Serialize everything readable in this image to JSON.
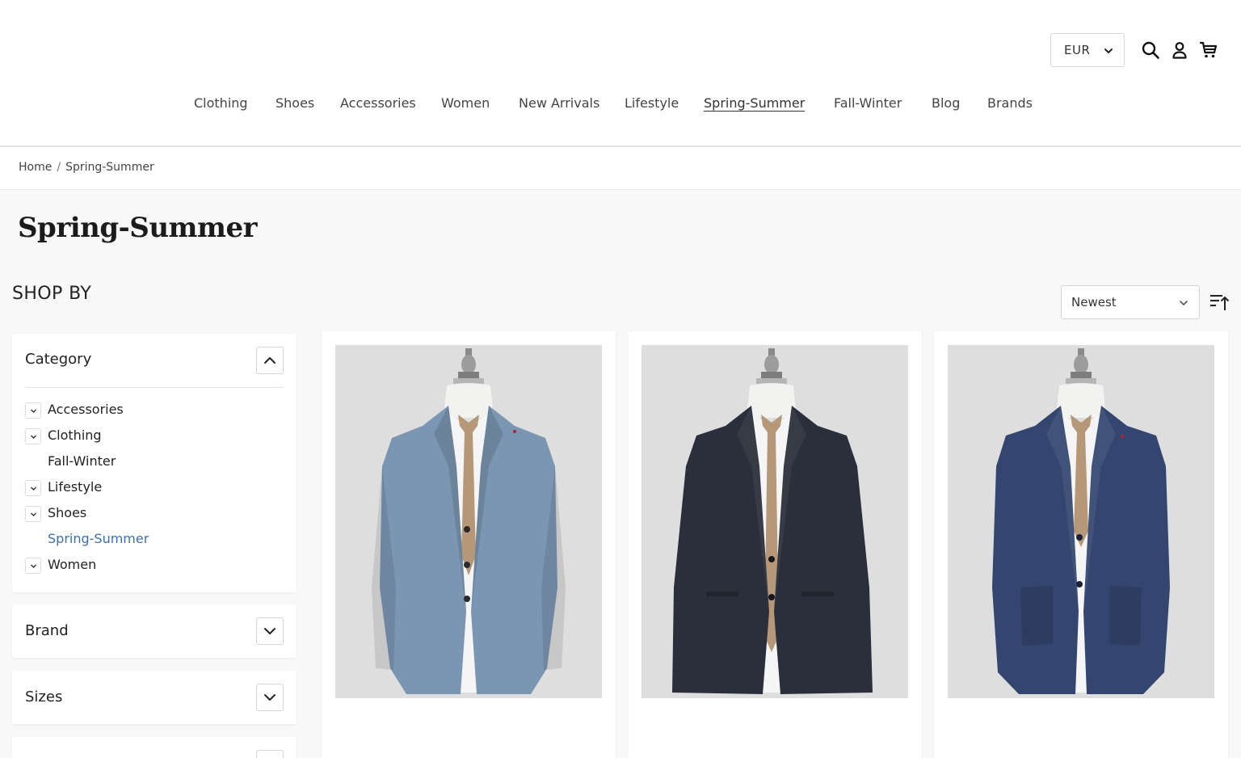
{
  "header": {
    "currency": "EUR",
    "icons": [
      "search-icon",
      "account-icon",
      "cart-icon"
    ]
  },
  "nav": {
    "items": [
      {
        "label": "Clothing"
      },
      {
        "label": "Shoes"
      },
      {
        "label": "Accessories"
      },
      {
        "label": "Women"
      },
      {
        "label": "New Arrivals"
      },
      {
        "label": "Lifestyle"
      },
      {
        "label": "Spring-Summer",
        "active": true
      },
      {
        "label": "Fall-Winter"
      },
      {
        "label": "Blog"
      },
      {
        "label": "Brands"
      }
    ]
  },
  "breadcrumb": {
    "home": "Home",
    "separator": "/",
    "current": "Spring-Summer"
  },
  "page": {
    "title": "Spring-Summer"
  },
  "sidebar": {
    "heading": "SHOP BY",
    "category": {
      "title": "Category",
      "expanded": true,
      "items": [
        {
          "label": "Accessories",
          "expandable": true
        },
        {
          "label": "Clothing",
          "expandable": true
        },
        {
          "label": "Fall-Winter",
          "expandable": false
        },
        {
          "label": "Lifestyle",
          "expandable": true
        },
        {
          "label": "Shoes",
          "expandable": true
        },
        {
          "label": "Spring-Summer",
          "expandable": false,
          "active": true
        },
        {
          "label": "Women",
          "expandable": true
        }
      ]
    },
    "filters": [
      {
        "title": "Brand",
        "expanded": false
      },
      {
        "title": "Sizes",
        "expanded": false
      }
    ]
  },
  "sort": {
    "selected": "Newest"
  },
  "products": [
    {
      "image": "light blue check blazer on mannequin",
      "jacket_color": "#7b96b2"
    },
    {
      "image": "dark navy blazer on mannequin",
      "jacket_color": "#2a2f3b"
    },
    {
      "image": "navy blue blazer on mannequin",
      "jacket_color": "#34466f"
    }
  ],
  "colors": {
    "accent": "#3d6fb0",
    "background": "#f8f8f8",
    "photo_bg": "#dededf"
  }
}
